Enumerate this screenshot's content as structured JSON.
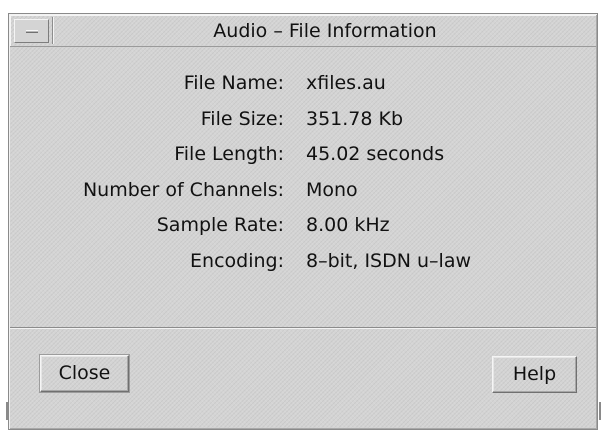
{
  "window": {
    "title": "Audio – File Information"
  },
  "file_info": {
    "rows": [
      {
        "label": "File Name:",
        "value": "xfiles.au"
      },
      {
        "label": "File Size:",
        "value": "351.78 Kb"
      },
      {
        "label": "File Length:",
        "value": "45.02 seconds"
      },
      {
        "label": "Number of Channels:",
        "value": "Mono"
      },
      {
        "label": "Sample Rate:",
        "value": "8.00 kHz"
      },
      {
        "label": "Encoding:",
        "value": "8–bit, ISDN u–law"
      }
    ]
  },
  "buttons": {
    "close_label": "Close",
    "help_label": "Help"
  }
}
